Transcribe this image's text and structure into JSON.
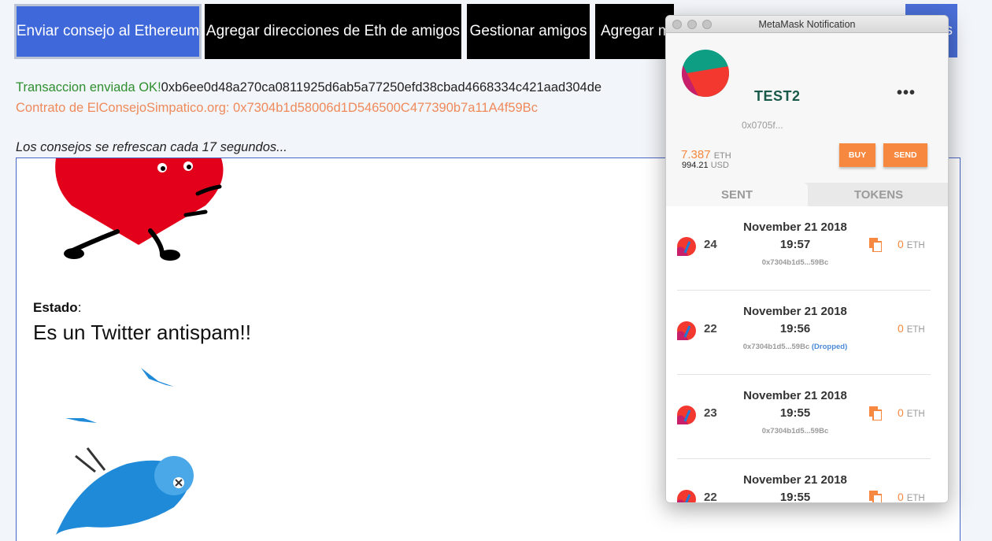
{
  "nav": {
    "buttons": [
      "Enviar consejo al Ethereum",
      "Agregar direcciones de Eth de amigos",
      "Gestionar amigos",
      "Agregar m",
      "s"
    ]
  },
  "status": {
    "tx_label": "Transaccion enviada OK!",
    "tx_hash": "0xb6ee0d48a270ca0811925d6ab5a77250efd38cbad4668334c421aad304de",
    "contract": "Contrato de ElConsejoSimpatico.org: 0x7304b1d58006d1D546500C477390b7a11A4f59Bc",
    "refresh": "Los consejos se refrescan cada 17 segundos..."
  },
  "advice": {
    "estado_label": "Estado",
    "estado_colon": ":",
    "estado_text": "Es un Twitter antispam!!"
  },
  "metamask": {
    "window_title": "MetaMask Notification",
    "account_name": "TEST2",
    "account_address": "0x0705f...",
    "balance_eth": "7.387",
    "balance_eth_unit": "ETH",
    "balance_usd": "994.21",
    "balance_usd_unit": "USD",
    "buy_label": "BUY",
    "send_label": "SEND",
    "tabs": [
      "SENT",
      "TOKENS"
    ],
    "transactions": [
      {
        "date": "November 21 2018",
        "time": "19:57",
        "nonce": "24",
        "to": "0x7304b1d5...59Bc",
        "status": "",
        "amount": "0",
        "unit": "ETH"
      },
      {
        "date": "November 21 2018",
        "time": "19:56",
        "nonce": "22",
        "to": "0x7304b1d5...59Bc",
        "status": "(Dropped)",
        "amount": "0",
        "unit": "ETH"
      },
      {
        "date": "November 21 2018",
        "time": "19:55",
        "nonce": "23",
        "to": "0x7304b1d5...59Bc",
        "status": "",
        "amount": "0",
        "unit": "ETH"
      },
      {
        "date": "November 21 2018",
        "time": "19:55",
        "nonce": "22",
        "to": "",
        "status": "",
        "amount": "0",
        "unit": "ETH"
      }
    ]
  },
  "colors": {
    "accent": "#3f68da",
    "metamask_orange": "#f6883f",
    "ok_green": "#2f8f2f",
    "contract_orange": "#ef8a5c"
  }
}
